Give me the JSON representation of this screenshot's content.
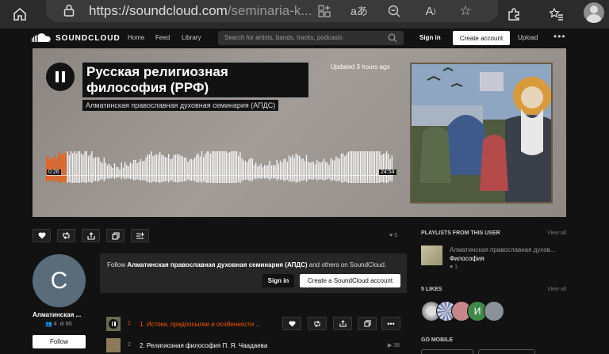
{
  "browser": {
    "url_domain": "https://soundcloud.com",
    "url_path": "/seminaria-k...",
    "icons": [
      "home-icon",
      "lock-icon",
      "app-install-icon",
      "read-aloud-icon",
      "zoom-out-icon",
      "reader-icon",
      "favorite-icon",
      "extensions-icon",
      "favorites-bar-icon",
      "profile-icon"
    ]
  },
  "header": {
    "logo_text": "SOUNDCLOUD",
    "nav": [
      "Home",
      "Feed",
      "Library"
    ],
    "search_placeholder": "Search for artists, bands, tracks, podcasts",
    "signin": "Sign in",
    "create_account": "Create account",
    "upload": "Upload"
  },
  "hero": {
    "title": "Русская религиозная философия (РРФ)",
    "artist": "Алматинская православная духовная семинария (АПДС)",
    "updated": "Updated 3 hours ago",
    "time_current": "0:26",
    "time_total": "24:54",
    "progress": 0.06
  },
  "actions": {
    "likes": "5"
  },
  "artist": {
    "initial": "C",
    "name": "Алматинская ...",
    "followers": "4",
    "tracks": "65",
    "follow_label": "Follow"
  },
  "follow_box": {
    "prefix": "Follow ",
    "name": "Алматинская православная духовная семинария (АПДС)",
    "suffix": " and others on SoundCloud.",
    "signin": "Sign in",
    "create": "Create a SoundCloud account"
  },
  "tracks": [
    {
      "num": "1",
      "title": "1. Истоки, предпосылки и особенности ...",
      "active": true
    },
    {
      "num": "2",
      "title": "2. Религиозная философия П. Я. Чаадаева",
      "plays": "38",
      "active": false
    }
  ],
  "sidebar": {
    "playlists_heading": "PLAYLISTS FROM THIS USER",
    "view_all": "View all",
    "playlist_artist": "Алматинская православная духов...",
    "playlist_title": "Философия",
    "playlist_likes": "1",
    "likes_heading": "5 LIKES",
    "like_avatar_initial": "И",
    "go_mobile": "GO MOBILE"
  },
  "colors": {
    "accent": "#ff5500",
    "background": "#121212"
  }
}
